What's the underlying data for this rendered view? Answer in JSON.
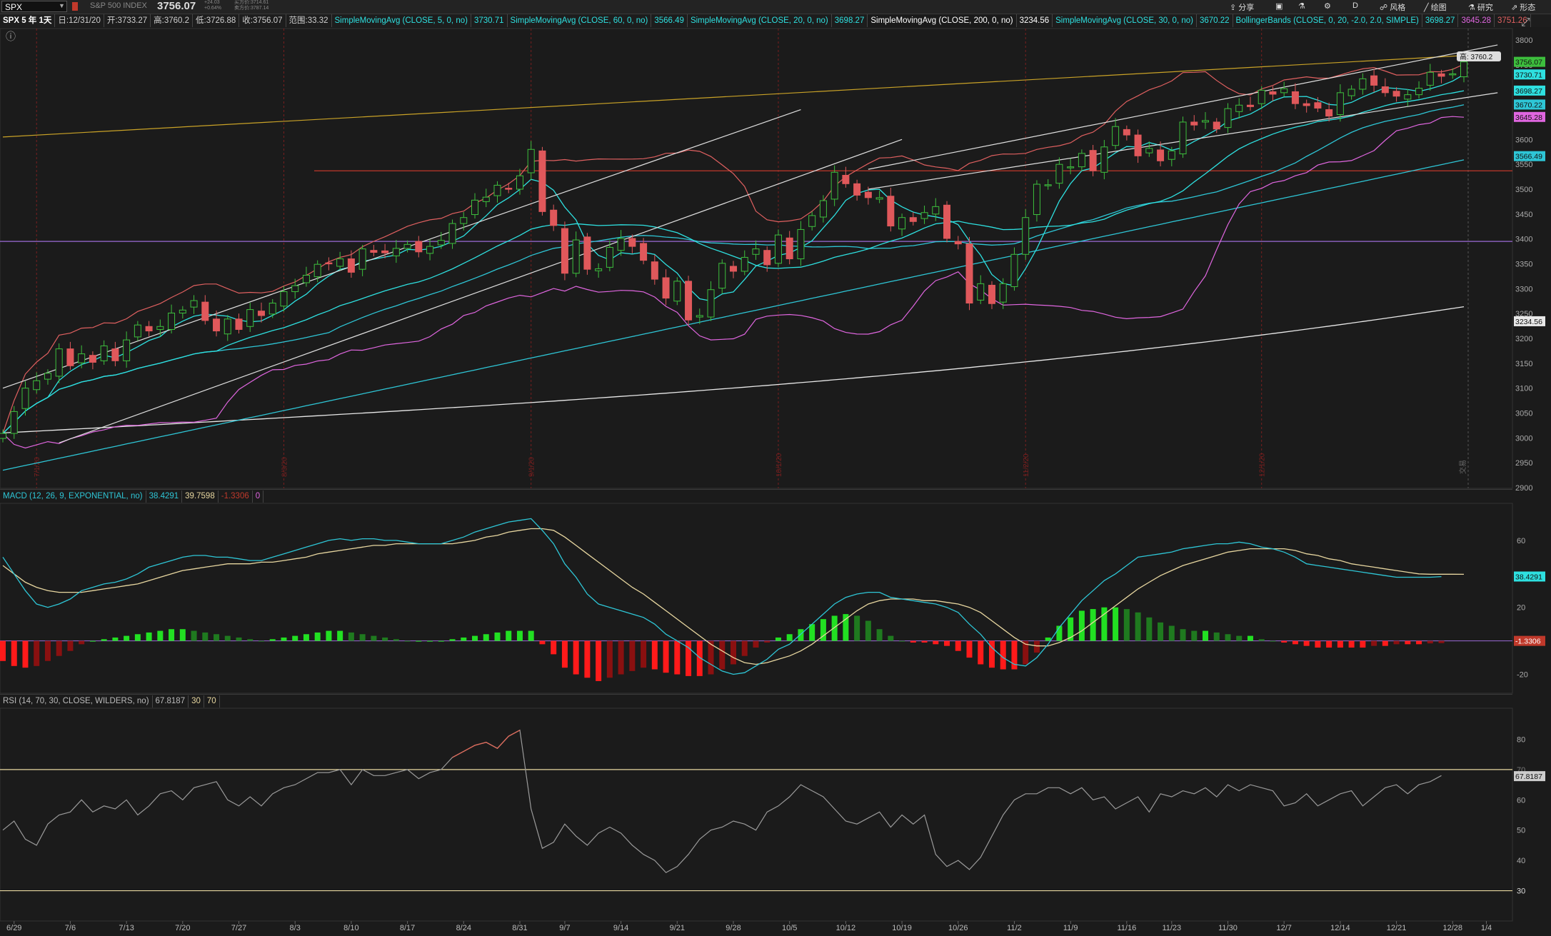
{
  "header": {
    "symbol": "SPX",
    "index_name": "S&P 500 INDEX",
    "last": "3756.07",
    "change": "+24.03",
    "change_pct": "+0.64%",
    "bid": "买方价:3714.61",
    "ask": "卖方价:3787.14",
    "tools": [
      "分享",
      "风格",
      "绘图",
      "研究",
      "形态"
    ],
    "period_btn": "D"
  },
  "infobar": {
    "title": "SPX 5 年 1天",
    "date": "日:12/31/20",
    "open": "开:3733.27",
    "high": "高:3760.2",
    "low": "低:3726.88",
    "close": "收:3756.07",
    "range": "范围:33.32",
    "studies": [
      {
        "label": "SimpleMovingAvg (CLOSE, 5, 0, no)",
        "value": "3730.71",
        "color": "#2ee0e0"
      },
      {
        "label": "SimpleMovingAvg (CLOSE, 60, 0, no)",
        "value": "3566.49",
        "color": "#2ec6d6"
      },
      {
        "label": "SimpleMovingAvg (CLOSE, 20, 0, no)",
        "value": "3698.27",
        "color": "#2ee0e0"
      },
      {
        "label": "SimpleMovingAvg (CLOSE, 200, 0, no)",
        "value": "3234.56",
        "color": "#e8e8e8"
      },
      {
        "label": "SimpleMovingAvg (CLOSE, 30, 0, no)",
        "value": "3670.22",
        "color": "#2ec6d6"
      },
      {
        "label": "BollingerBands (CLOSE, 0, 20, -2.0, 2.0, SIMPLE)",
        "value": "3698.27",
        "color": "#2ec6d6"
      }
    ],
    "bb_lower": "3645.28",
    "bb_upper": "3751.26",
    "bb_lower_color": "#e066e0",
    "bb_upper_color": "#e06060"
  },
  "price_pane": {
    "high_tag": "高: 3760.2",
    "right_labels": [
      {
        "text": "3756.07",
        "value": 3756.07,
        "color": "#3dbf3d"
      },
      {
        "text": "3730.71",
        "value": 3730.71,
        "color": "#2ee0e0"
      },
      {
        "text": "3698.27",
        "value": 3698.27,
        "color": "#2ee0e0"
      },
      {
        "text": "3670.22",
        "value": 3670.22,
        "color": "#2ec6d6"
      },
      {
        "text": "3645.28",
        "value": 3645.28,
        "color": "#e066e0"
      },
      {
        "text": "3566.49",
        "value": 3566.49,
        "color": "#2ec6d6"
      },
      {
        "text": "3234.56",
        "value": 3234.56,
        "color": "#e8e8e8"
      }
    ],
    "month_markers": [
      "7/1/20",
      "8/3/20",
      "9/1/20",
      "10/1/20",
      "11/2/20",
      "12/1/20"
    ],
    "expiry_label": "交易"
  },
  "macd_pane": {
    "label": "MACD (12, 26, 9, EXPONENTIAL, no)",
    "value": "38.4291",
    "avg": "39.7598",
    "diff": "-1.3306",
    "zero": "0",
    "right_value": "38.4291",
    "right_diff": "-1.3306"
  },
  "rsi_pane": {
    "label": "RSI (14, 70, 30, CLOSE, WILDERS, no)",
    "value": "67.8187",
    "lower": "30",
    "upper": "70",
    "right_value": "67.8187",
    "right_70": "70",
    "right_30": "30"
  },
  "xaxis": {
    "labels": [
      "6/29",
      "7/6",
      "7/13",
      "7/20",
      "7/27",
      "8/3",
      "8/10",
      "8/17",
      "8/24",
      "8/31",
      "9/7",
      "9/14",
      "9/21",
      "9/28",
      "10/5",
      "10/12",
      "10/19",
      "10/26",
      "11/2",
      "11/9",
      "11/16",
      "11/23",
      "11/30",
      "12/7",
      "12/14",
      "12/21",
      "12/28",
      "1/4"
    ],
    "start_date": "2020-06-29",
    "end_date": "2021-01-04"
  },
  "chart_data": [
    {
      "type": "candlestick",
      "title": "SPX 5 年 1天",
      "x": [
        "6/26",
        "6/29",
        "6/30",
        "7/1",
        "7/2",
        "7/6",
        "7/7",
        "7/8",
        "7/9",
        "7/10",
        "7/13",
        "7/14",
        "7/15",
        "7/16",
        "7/17",
        "7/20",
        "7/21",
        "7/22",
        "7/23",
        "7/24",
        "7/27",
        "7/28",
        "7/29",
        "7/30",
        "7/31",
        "8/3",
        "8/4",
        "8/5",
        "8/6",
        "8/7",
        "8/10",
        "8/11",
        "8/12",
        "8/13",
        "8/14",
        "8/17",
        "8/18",
        "8/19",
        "8/20",
        "8/21",
        "8/24",
        "8/25",
        "8/26",
        "8/27",
        "8/28",
        "8/31",
        "9/1",
        "9/2",
        "9/3",
        "9/4",
        "9/8",
        "9/9",
        "9/10",
        "9/11",
        "9/14",
        "9/15",
        "9/16",
        "9/17",
        "9/18",
        "9/21",
        "9/22",
        "9/23",
        "9/24",
        "9/25",
        "9/28",
        "9/29",
        "9/30",
        "10/1",
        "10/2",
        "10/5",
        "10/6",
        "10/7",
        "10/8",
        "10/9",
        "10/12",
        "10/13",
        "10/14",
        "10/15",
        "10/16",
        "10/19",
        "10/20",
        "10/21",
        "10/22",
        "10/23",
        "10/26",
        "10/27",
        "10/28",
        "10/29",
        "10/30",
        "11/2",
        "11/3",
        "11/4",
        "11/5",
        "11/6",
        "11/9",
        "11/10",
        "11/11",
        "11/12",
        "11/13",
        "11/16",
        "11/17",
        "11/18",
        "11/19",
        "11/20",
        "11/23",
        "11/24",
        "11/25",
        "11/27",
        "11/30",
        "12/1",
        "12/2",
        "12/3",
        "12/4",
        "12/7",
        "12/8",
        "12/9",
        "12/10",
        "12/11",
        "12/14",
        "12/15",
        "12/16",
        "12/17",
        "12/18",
        "12/21",
        "12/22",
        "12/23",
        "12/24",
        "12/28",
        "12/29",
        "12/30",
        "12/31"
      ],
      "close": [
        3009,
        3053,
        3100,
        3115,
        3130,
        3179,
        3145,
        3169,
        3152,
        3185,
        3155,
        3197,
        3227,
        3215,
        3224,
        3251,
        3257,
        3276,
        3236,
        3215,
        3239,
        3218,
        3258,
        3246,
        3271,
        3294,
        3306,
        3327,
        3349,
        3351,
        3360,
        3333,
        3380,
        3373,
        3372,
        3381,
        3389,
        3374,
        3385,
        3397,
        3431,
        3443,
        3478,
        3484,
        3508,
        3500,
        3527,
        3580,
        3455,
        3427,
        3331,
        3398,
        3339,
        3340,
        3383,
        3401,
        3385,
        3357,
        3319,
        3281,
        3315,
        3237,
        3246,
        3298,
        3351,
        3335,
        3363,
        3380,
        3348,
        3408,
        3360,
        3419,
        3447,
        3477,
        3534,
        3511,
        3488,
        3483,
        3483,
        3426,
        3443,
        3435,
        3453,
        3465,
        3401,
        3390,
        3271,
        3310,
        3270,
        3310,
        3369,
        3443,
        3510,
        3509,
        3550,
        3545,
        3572,
        3537,
        3585,
        3626,
        3609,
        3567,
        3582,
        3557,
        3577,
        3635,
        3629,
        3638,
        3621,
        3662,
        3669,
        3666,
        3699,
        3691,
        3702,
        3672,
        3668,
        3663,
        3647,
        3694,
        3701,
        3722,
        3709,
        3694,
        3687,
        3690,
        3703,
        3735,
        3727,
        3732,
        3756
      ],
      "ylim": [
        2900,
        3800
      ]
    },
    {
      "type": "line",
      "title": "MACD (12, 26, 9, EXPONENTIAL, no)",
      "series": [
        {
          "name": "Value",
          "values": [
            50,
            40,
            30,
            22,
            20,
            22,
            25,
            30,
            32,
            34,
            35,
            37,
            40,
            44,
            46,
            48,
            50,
            51,
            51,
            50,
            50,
            49,
            48,
            48,
            50,
            52,
            54,
            56,
            58,
            60,
            61,
            60,
            61,
            61,
            60,
            60,
            59,
            58,
            58,
            58,
            60,
            62,
            65,
            67,
            69,
            71,
            72,
            73,
            66,
            58,
            46,
            38,
            28,
            22,
            20,
            18,
            16,
            14,
            10,
            4,
            0,
            -4,
            -10,
            -14,
            -18,
            -20,
            -19,
            -15,
            -11,
            -5,
            -2,
            4,
            10,
            16,
            22,
            26,
            28,
            29,
            29,
            26,
            25,
            24,
            23,
            22,
            20,
            17,
            10,
            4,
            -4,
            -10,
            -14,
            -15,
            -10,
            -2,
            8,
            16,
            24,
            30,
            36,
            40,
            45,
            50,
            51,
            52,
            53,
            55,
            56,
            57,
            58,
            58,
            59,
            58,
            56,
            55,
            53,
            50,
            46,
            45,
            44,
            43,
            42,
            41,
            40,
            39,
            38,
            38,
            38,
            38,
            38.4
          ],
          "color": "#2ec6d6"
        },
        {
          "name": "Avg",
          "values": [
            45,
            40,
            35,
            32,
            30,
            29,
            29,
            29,
            30,
            31,
            32,
            33,
            34,
            36,
            38,
            40,
            42,
            43,
            44,
            45,
            46,
            46,
            46,
            47,
            47,
            48,
            49,
            50,
            52,
            53,
            54,
            55,
            56,
            57,
            57,
            58,
            58,
            58,
            58,
            58,
            58,
            59,
            60,
            62,
            63,
            65,
            66,
            67,
            67,
            66,
            62,
            57,
            52,
            47,
            42,
            37,
            32,
            28,
            23,
            18,
            13,
            8,
            3,
            -2,
            -6,
            -10,
            -13,
            -14,
            -13,
            -11,
            -9,
            -6,
            -2,
            3,
            8,
            13,
            18,
            22,
            24,
            25,
            25,
            25,
            24,
            24,
            23,
            22,
            20,
            17,
            12,
            7,
            2,
            -2,
            -3,
            -3,
            -1,
            2,
            6,
            11,
            16,
            21,
            26,
            31,
            35,
            39,
            42,
            45,
            47,
            49,
            51,
            53,
            54,
            55,
            55,
            55,
            55,
            54,
            52,
            51,
            49,
            48,
            46,
            45,
            44,
            43,
            42,
            41,
            40,
            39.8,
            39.8,
            39.8,
            39.76
          ],
          "color": "#e8d7a0"
        }
      ],
      "ylim": [
        -30,
        80
      ]
    },
    {
      "type": "bar",
      "title": "MACD Diff",
      "values": [
        -12,
        -15,
        -16,
        -15,
        -12,
        -9,
        -6,
        -2,
        0,
        1,
        2,
        3,
        4,
        5,
        6,
        7,
        7,
        6,
        5,
        4,
        3,
        2,
        1,
        0,
        1,
        2,
        3,
        4,
        5,
        6,
        6,
        5,
        4,
        3,
        2,
        1,
        0,
        0,
        0,
        0,
        1,
        2,
        3,
        4,
        5,
        6,
        6,
        6,
        -2,
        -8,
        -16,
        -20,
        -22,
        -24,
        -22,
        -20,
        -18,
        -16,
        -17,
        -19,
        -20,
        -21,
        -21,
        -20,
        -17,
        -14,
        -9,
        -4,
        -1,
        2,
        4,
        7,
        10,
        13,
        15,
        16,
        15,
        12,
        7,
        3,
        0,
        -1,
        -1,
        -2,
        -3,
        -6,
        -10,
        -14,
        -16,
        -17,
        -17,
        -14,
        -7,
        2,
        9,
        14,
        18,
        19,
        20,
        20,
        19,
        17,
        14,
        11,
        9,
        7,
        6,
        6,
        5,
        4,
        3,
        3,
        1,
        0,
        -1,
        -2,
        -3,
        -4,
        -4,
        -4,
        -4,
        -4,
        -3,
        -3,
        -2,
        -2,
        -2,
        -1.5,
        -1.3306
      ],
      "ylim": [
        -30,
        80
      ]
    },
    {
      "type": "line",
      "title": "RSI (14, 70, 30, CLOSE, WILDERS, no)",
      "series": [
        {
          "name": "RSI",
          "values": [
            50,
            53,
            47,
            45,
            52,
            55,
            56,
            60,
            56,
            58,
            57,
            60,
            55,
            58,
            62,
            63,
            60,
            64,
            65,
            66,
            60,
            58,
            61,
            58,
            62,
            64,
            65,
            67,
            69,
            69,
            70,
            65,
            70,
            68,
            68,
            69,
            70,
            67,
            69,
            70,
            74,
            76,
            78,
            79,
            77,
            81,
            83,
            57,
            44,
            46,
            52,
            48,
            45,
            49,
            51,
            49,
            45,
            42,
            40,
            36,
            38,
            42,
            47,
            50,
            51,
            53,
            52,
            50,
            56,
            58,
            61,
            65,
            63,
            61,
            57,
            53,
            52,
            54,
            56,
            51,
            55,
            52,
            55,
            42,
            38,
            40,
            37,
            41,
            48,
            55,
            60,
            62,
            62,
            64,
            64,
            62,
            64,
            60,
            61,
            57,
            59,
            61,
            56,
            62,
            61,
            63,
            62,
            64,
            61,
            65,
            63,
            65,
            64,
            63,
            58,
            59,
            62,
            58,
            60,
            62,
            63,
            58,
            61,
            64,
            65,
            62,
            65,
            66,
            68
          ],
          "color": "#9a9a9a"
        }
      ],
      "ylim": [
        20,
        90
      ],
      "levels": [
        30,
        70
      ]
    }
  ]
}
